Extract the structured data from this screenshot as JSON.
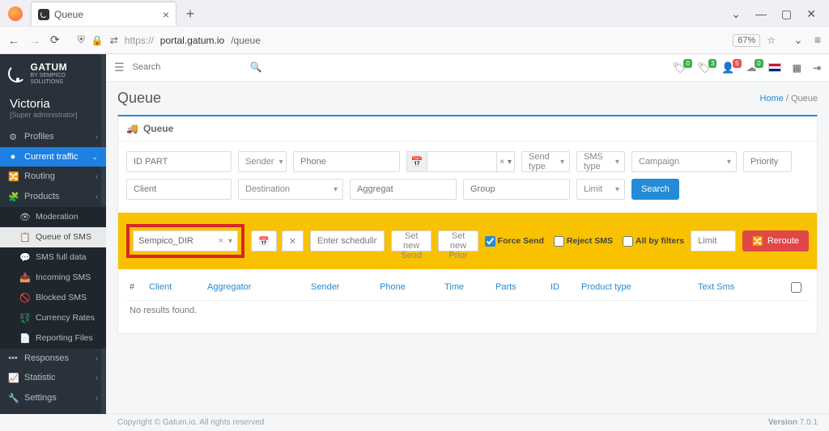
{
  "browser": {
    "tab_title": "Queue",
    "url_prefix": "https://",
    "url_host": "portal.gatum.io",
    "url_path": "/queue",
    "zoom": "67%"
  },
  "brand": {
    "title": "GATUM",
    "subtitle": "BY SEMPICO SOLUTIONS"
  },
  "user": {
    "name": "Victoria",
    "role": "[Super administrator]"
  },
  "sidebar": {
    "items": [
      {
        "label": "Profiles",
        "chev": true
      },
      {
        "label": "Current traffic",
        "chev": true,
        "highlight": true
      },
      {
        "label": "Routing",
        "chev": true
      },
      {
        "label": "Products",
        "chev": true
      },
      {
        "label": "Moderation"
      },
      {
        "label": "Queue of SMS",
        "active": true
      },
      {
        "label": "SMS full data"
      },
      {
        "label": "Incoming SMS"
      },
      {
        "label": "Blocked SMS"
      },
      {
        "label": "Currency Rates"
      },
      {
        "label": "Reporting Files"
      },
      {
        "label": "Responses",
        "chev": true
      },
      {
        "label": "Statistic",
        "chev": true
      },
      {
        "label": "Settings",
        "chev": true
      }
    ]
  },
  "topbar": {
    "search_placeholder": "Search",
    "badges": [
      "0",
      "3",
      "5",
      "0"
    ]
  },
  "page": {
    "title": "Queue",
    "breadcrumb_home": "Home",
    "breadcrumb_current": "Queue",
    "panel_title": "Queue"
  },
  "filters": {
    "id_part": "ID PART",
    "sender": "Sender",
    "phone": "Phone",
    "send_type": "Send type",
    "sms_type": "SMS type",
    "campaign": "Campaign",
    "priority": "Priority",
    "client": "Client",
    "destination": "Destination",
    "aggregat": "Aggregat",
    "group": "Group",
    "limit": "Limit",
    "search_btn": "Search"
  },
  "reroute": {
    "dest_value": "Sempico_DIR",
    "schedule_placeholder": "Enter scheduling date!",
    "set_send": "Set new Send",
    "set_prior": "Set new Prior",
    "force_send": "Force Send",
    "reject_sms": "Reject SMS",
    "all_by_filters": "All by filters",
    "limit": "Limit",
    "reroute_btn": "Reroute"
  },
  "table": {
    "hash": "#",
    "headers": [
      "Client",
      "Aggregator",
      "Sender",
      "Phone",
      "Time",
      "Parts",
      "ID",
      "Product type",
      "Text Sms"
    ],
    "empty": "No results found."
  },
  "footer": {
    "copyright": "Copyright © Gatum.io. All rights reserved",
    "version_label": "Version ",
    "version": "7.0.1"
  }
}
